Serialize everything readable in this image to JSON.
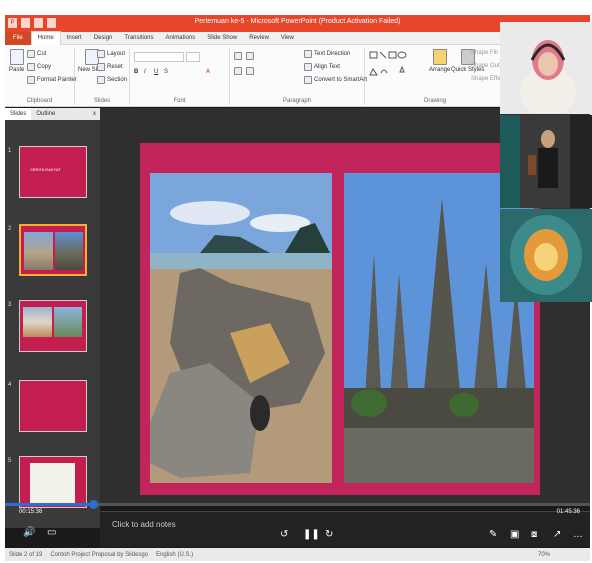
{
  "window": {
    "title": "Pertemuan ke-5 - Microsoft PowerPoint (Product Activation Failed)"
  },
  "ribbon_tabs": [
    "File",
    "Home",
    "Insert",
    "Design",
    "Transitions",
    "Animations",
    "Slide Show",
    "Review",
    "View"
  ],
  "ribbon": {
    "clipboard": {
      "paste": "Paste",
      "cut": "Cut",
      "copy": "Copy",
      "format_painter": "Format Painter",
      "label": "Clipboard"
    },
    "slides": {
      "new_slide": "New Slide",
      "layout": "Layout",
      "reset": "Reset",
      "section": "Section",
      "label": "Slides"
    },
    "font": {
      "label": "Font"
    },
    "paragraph": {
      "text_direction": "Text Direction",
      "align_text": "Align Text",
      "convert": "Convert to SmartArt",
      "label": "Paragraph"
    },
    "drawing": {
      "arrange": "Arrange",
      "quick_styles": "Quick Styles",
      "shape_fill": "Shape Fill",
      "shape_outline": "Shape Outline",
      "shape_effects": "Shape Effects",
      "label": "Drawing"
    }
  },
  "left_pane": {
    "tabs": [
      "Slides",
      "Outline"
    ],
    "close": "x",
    "thumbnails": [
      {
        "num": "1",
        "title": "CERITA RAKYAT"
      },
      {
        "num": "2"
      },
      {
        "num": "3"
      },
      {
        "num": "4"
      },
      {
        "num": "5"
      }
    ]
  },
  "notes": {
    "placeholder": "Click to add notes"
  },
  "video": {
    "elapsed": "00:15:36",
    "remaining": "01:45:36"
  },
  "status": {
    "slide": "Slide 2 of 19",
    "theme": "Contoh Project Proposal by Slidesgo",
    "language": "English (U.S.)",
    "zoom": "70%"
  },
  "colors": {
    "slide_bg": "#c2255c",
    "accent": "#e8462b",
    "selected": "#f2b12f"
  }
}
